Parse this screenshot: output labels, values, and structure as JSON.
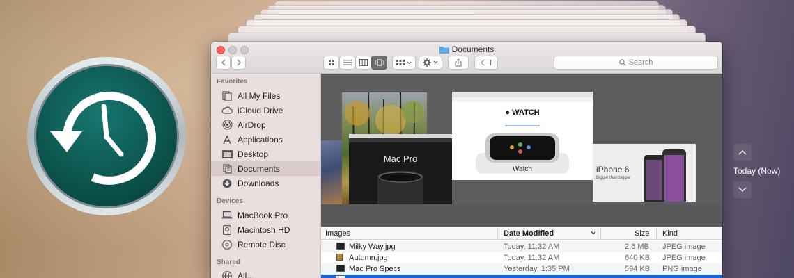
{
  "window": {
    "title": "Documents"
  },
  "toolbar": {
    "search_placeholder": "Search"
  },
  "sidebar": {
    "favorites_heading": "Favorites",
    "favorites": [
      {
        "label": "All My Files",
        "icon": "all-files-icon"
      },
      {
        "label": "iCloud Drive",
        "icon": "cloud-icon"
      },
      {
        "label": "AirDrop",
        "icon": "airdrop-icon"
      },
      {
        "label": "Applications",
        "icon": "applications-icon"
      },
      {
        "label": "Desktop",
        "icon": "desktop-icon"
      },
      {
        "label": "Documents",
        "icon": "documents-icon",
        "selected": true
      },
      {
        "label": "Downloads",
        "icon": "downloads-icon"
      }
    ],
    "devices_heading": "Devices",
    "devices": [
      {
        "label": "MacBook Pro",
        "icon": "laptop-icon"
      },
      {
        "label": "Macintosh HD",
        "icon": "disk-icon"
      },
      {
        "label": "Remote Disc",
        "icon": "disc-icon"
      }
    ],
    "shared_heading": "Shared",
    "shared": [
      {
        "label": "All...",
        "icon": "network-icon"
      }
    ]
  },
  "coverflow": {
    "covers": {
      "mac_pro_title": "Mac Pro",
      "watch_heading": "WATCH",
      "watch_caption": "Watch",
      "iphone_title": "iPhone 6",
      "iphone_subtitle": "Bigger than bigger"
    }
  },
  "list": {
    "columns": {
      "name": "Images",
      "date": "Date Modified",
      "size": "Size",
      "kind": "Kind"
    },
    "rows": [
      {
        "name": "Milky Way.jpg",
        "date": "Today, 11:32 AM",
        "size": "2.6 MB",
        "kind": "JPEG image"
      },
      {
        "name": "Autumn.jpg",
        "date": "Today, 11:32 AM",
        "size": "640 KB",
        "kind": "JPEG image"
      },
      {
        "name": "Mac Pro Specs",
        "date": "Yesterday, 1:35 PM",
        "size": "594 KB",
        "kind": "PNG image"
      }
    ]
  },
  "timeline": {
    "today_label": "Today (Now)"
  },
  "colors": {
    "selection": "#1a62d6",
    "tm_green": "#0d5b57",
    "close_red": "#fc615d"
  }
}
